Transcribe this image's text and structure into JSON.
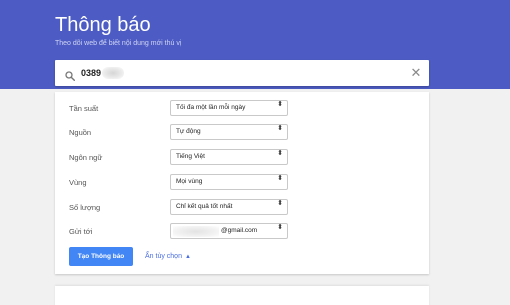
{
  "header": {
    "title": "Thông báo",
    "subtitle": "Theo dõi web để biết nội dung mới thú vị"
  },
  "search": {
    "value": "0389",
    "search_icon": "search-icon",
    "clear_icon": "close-icon",
    "clear_glyph": "✕"
  },
  "options": [
    {
      "label": "Tần suất",
      "value": "Tối đa một lần mỗi ngày"
    },
    {
      "label": "Nguồn",
      "value": "Tự động"
    },
    {
      "label": "Ngôn ngữ",
      "value": "Tiếng Việt"
    },
    {
      "label": "Vùng",
      "value": "Mọi vùng"
    },
    {
      "label": "Số lượng",
      "value": "Chỉ kết quả tốt nhất"
    },
    {
      "label": "Gửi tới",
      "value": "@gmail.com"
    }
  ],
  "select_arrow_glyph": "⬍",
  "actions": {
    "create_label": "Tạo Thông báo",
    "hide_options_label": "Ẩn tùy chọn",
    "hide_options_caret": "▲"
  },
  "colors": {
    "header_bg": "#4d5cc4",
    "primary_button": "#4285f4",
    "link": "#4a6ee0"
  }
}
